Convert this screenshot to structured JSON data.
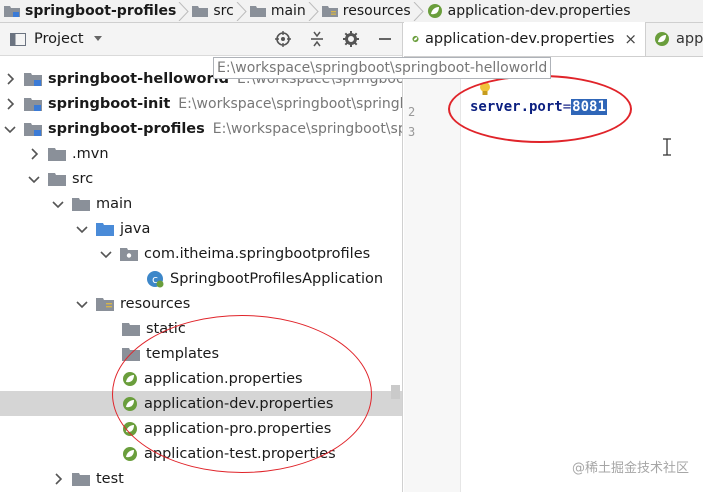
{
  "breadcrumb": [
    {
      "label": "springboot-profiles",
      "icon": "module-folder-icon"
    },
    {
      "label": "src",
      "icon": "folder-icon"
    },
    {
      "label": "main",
      "icon": "folder-icon"
    },
    {
      "label": "resources",
      "icon": "resources-folder-icon"
    },
    {
      "label": "application-dev.properties",
      "icon": "spring-properties-icon"
    }
  ],
  "project_panel": {
    "title": "Project",
    "tools": [
      "locate-icon",
      "collapse-all-icon",
      "settings-gear-icon",
      "hide-panel-icon"
    ]
  },
  "tree": [
    {
      "label": "springboot-helloworld",
      "path": "E:\\workspace\\springboot\\springboot-helloworld",
      "expanded": false
    },
    {
      "label": "springboot-init",
      "path": "E:\\workspace\\springboot\\springbo",
      "expanded": false
    },
    {
      "label": "springboot-profiles",
      "path": "E:\\workspace\\springboot\\sp",
      "expanded": true
    },
    {
      "label": ".mvn",
      "expanded": false
    },
    {
      "label": "src",
      "expanded": true
    },
    {
      "label": "main",
      "expanded": true
    },
    {
      "label": "java",
      "expanded": true
    },
    {
      "label": "com.itheima.springbootprofiles",
      "expanded": true
    },
    {
      "label": "SpringbootProfilesApplication"
    },
    {
      "label": "resources",
      "expanded": true
    },
    {
      "label": "static"
    },
    {
      "label": "templates"
    },
    {
      "label": "application.properties"
    },
    {
      "label": "application-dev.properties",
      "selected": true
    },
    {
      "label": "application-pro.properties"
    },
    {
      "label": "application-test.properties"
    },
    {
      "label": "test",
      "expanded": false
    }
  ],
  "tooltip": "E:\\workspace\\springboot\\springboot-helloworld",
  "editor": {
    "tabs": [
      {
        "label": "application-dev.properties",
        "active": true,
        "close": "×"
      },
      {
        "label": "appl",
        "active": false
      }
    ],
    "line_numbers": [
      "2",
      "3"
    ],
    "code": {
      "key": "server.port",
      "eq": "=",
      "value": "8081"
    }
  },
  "watermark": "@稀土掘金技术社区",
  "colors": {
    "annotation": "#e0242a",
    "selection": "#2f66b8",
    "row_selected": "#d5d5d5"
  }
}
